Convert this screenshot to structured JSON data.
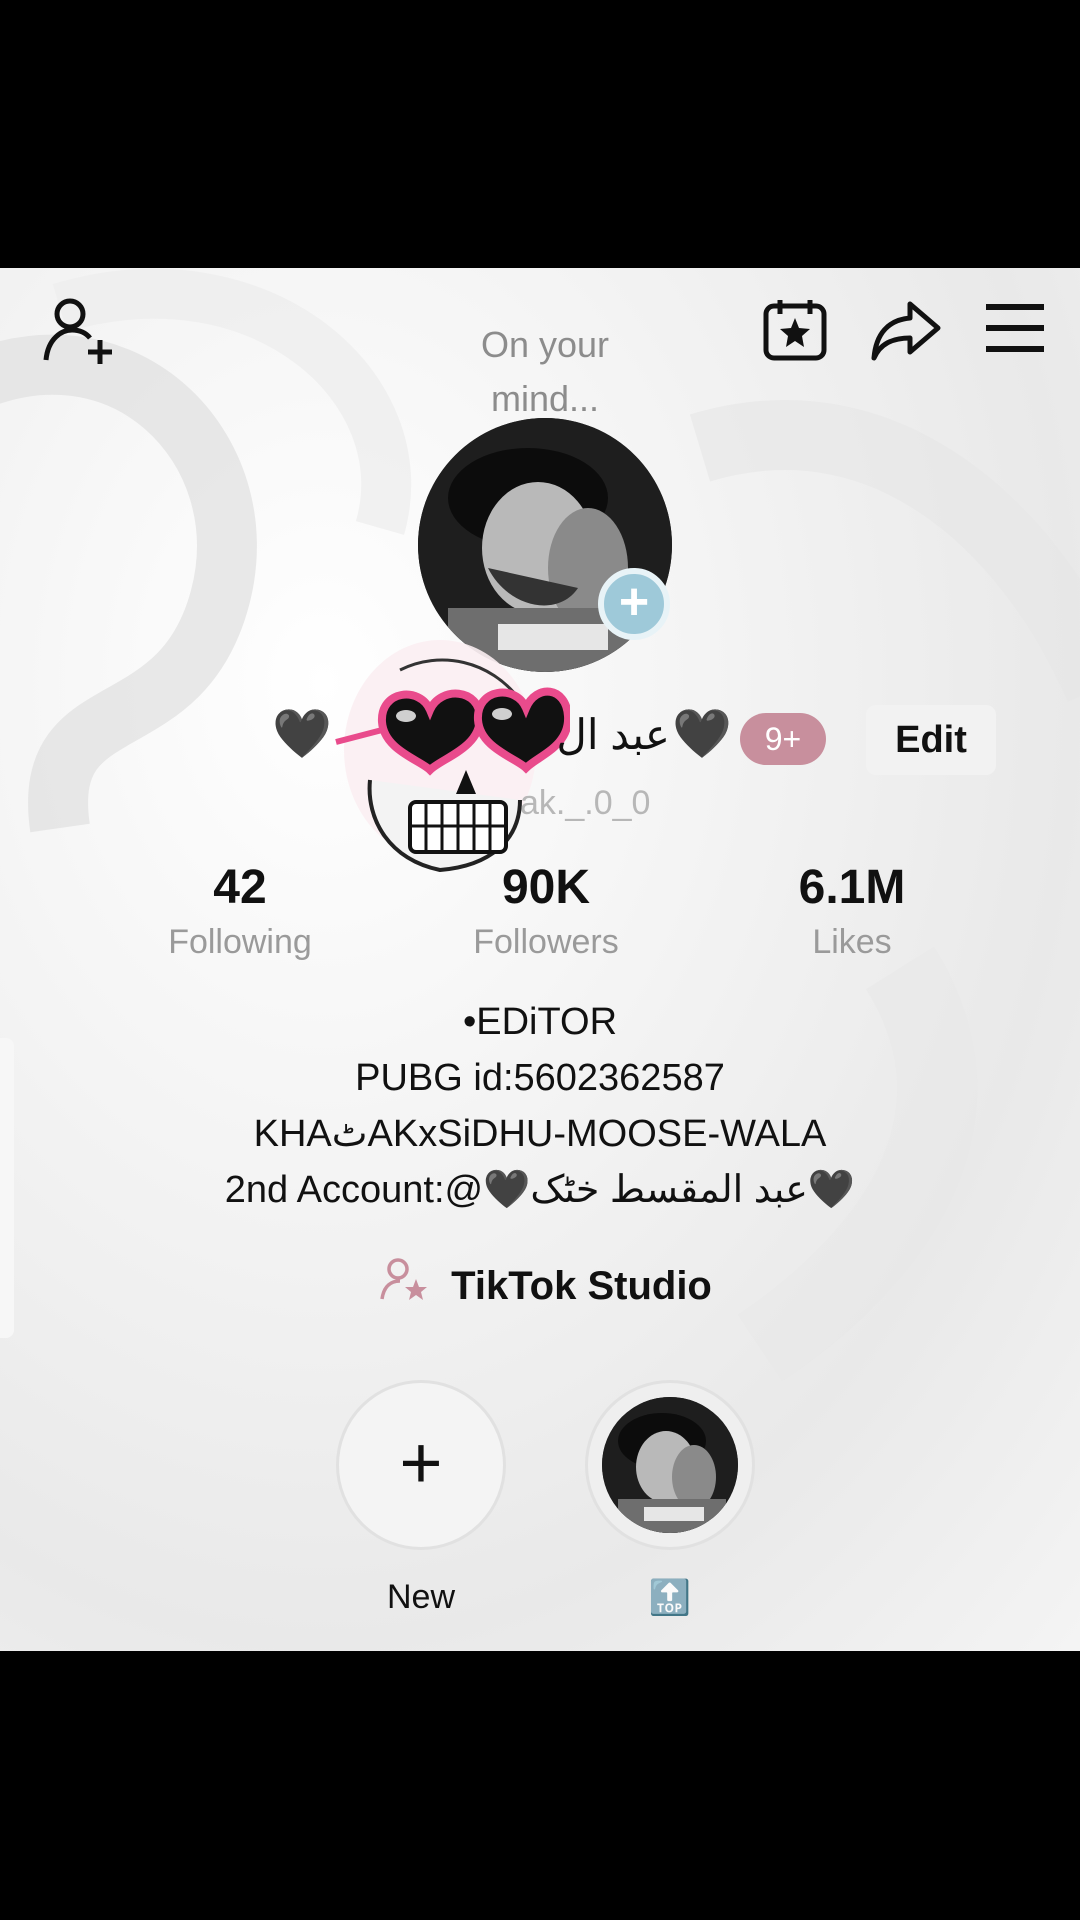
{
  "header": {
    "story_prompt": "On your mind...",
    "icons": [
      "add-friend-icon",
      "calendar-star-icon",
      "share-icon",
      "menu-icon"
    ]
  },
  "profile": {
    "display_name": "عبد ال",
    "heart_emoji": "🖤",
    "notification_badge": "9+",
    "edit_label": "Edit",
    "username_partial": "ak._.0_0"
  },
  "stats": [
    {
      "value": "42",
      "label": "Following"
    },
    {
      "value": "90K",
      "label": "Followers"
    },
    {
      "value": "6.1M",
      "label": "Likes"
    }
  ],
  "bio": {
    "lines": [
      "•EDiTOR",
      "PUBG id:5602362587",
      "KHAٹAKxSiDHU-MOOSE-WALA",
      "2nd Account:@🖤عبد المقسط خٹک🖤"
    ]
  },
  "studio": {
    "label": "TikTok Studio"
  },
  "highlights": [
    {
      "label": "New",
      "icon": "plus-icon"
    },
    {
      "label": "🔝",
      "icon": "avatar-thumbnail"
    }
  ],
  "colors": {
    "badge": "#c88f9d",
    "heart_glasses": "#e94b8c",
    "avatar_add": "#9ec9d9",
    "muted_text": "#9a9a9a"
  }
}
